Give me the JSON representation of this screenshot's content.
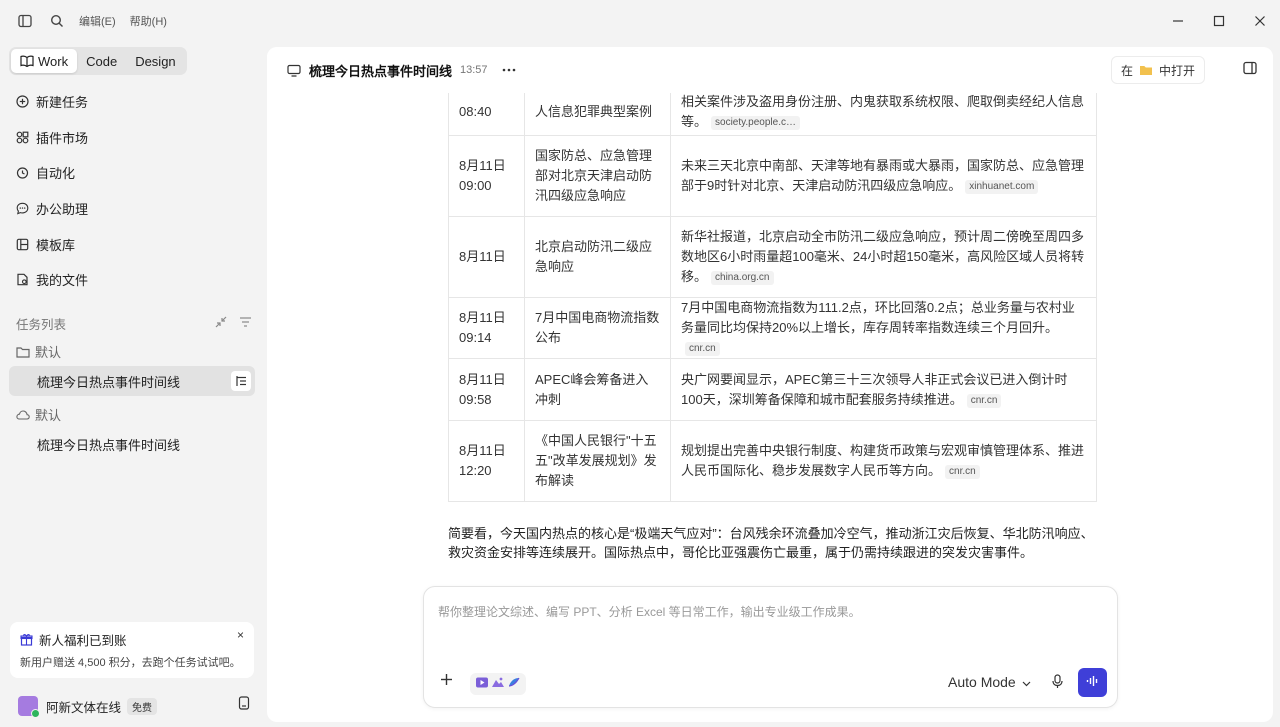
{
  "menu": {
    "edit": "编辑(E)",
    "help": "帮助(H)"
  },
  "mode_tabs": [
    {
      "label": "Work"
    },
    {
      "label": "Code"
    },
    {
      "label": "Design"
    }
  ],
  "nav": [
    {
      "label": "新建任务"
    },
    {
      "label": "插件市场"
    },
    {
      "label": "自动化"
    },
    {
      "label": "办公助理"
    },
    {
      "label": "模板库"
    },
    {
      "label": "我的文件"
    }
  ],
  "task_list": {
    "heading": "任务列表",
    "groups": [
      {
        "name": "默认",
        "task": "梳理今日热点事件时间线"
      },
      {
        "name": "默认",
        "task": "梳理今日热点事件时间线"
      }
    ]
  },
  "promo": {
    "title": "新人福利已到账",
    "desc": "新用户赠送 4,500 积分，去跑个任务试试吧。",
    "close": "×"
  },
  "user": {
    "name": "阿新文体在线",
    "plan": "免费"
  },
  "header": {
    "title": "梳理今日热点事件时间线",
    "time": "13:57",
    "open_prefix": "在",
    "open_label": "中打开"
  },
  "table": {
    "rows": [
      {
        "time": "08:40",
        "event": "人信息犯罪典型案例",
        "detail": "相关案件涉及盗用身份注册、内鬼获取系统权限、爬取倒卖经纪人信息等。",
        "source": "society.people.c…"
      },
      {
        "time": "8月11日 09:00",
        "event": "国家防总、应急管理部对北京天津启动防汛四级应急响应",
        "detail": "未来三天北京中南部、天津等地有暴雨或大暴雨，国家防总、应急管理部于9时针对北京、天津启动防汛四级应急响应。",
        "source": "xinhuanet.com"
      },
      {
        "time": "8月11日",
        "event": "北京启动防汛二级应急响应",
        "detail": "新华社报道，北京启动全市防汛二级应急响应，预计周二傍晚至周四多数地区6小时雨量超100毫米、24小时超150毫米，高风险区域人员将转移。",
        "source": "china.org.cn"
      },
      {
        "time": "8月11日 09:14",
        "event": "7月中国电商物流指数公布",
        "detail": "7月中国电商物流指数为111.2点，环比回落0.2点；总业务量与农村业务量同比均保持20%以上增长，库存周转率指数连续三个月回升。",
        "source": "cnr.cn"
      },
      {
        "time": "8月11日 09:58",
        "event": "APEC峰会筹备进入冲刺",
        "detail": "央广网要闻显示，APEC第三十三次领导人非正式会议已进入倒计时100天，深圳筹备保障和城市配套服务持续推进。",
        "source": "cnr.cn"
      },
      {
        "time": "8月11日 12:20",
        "event": "《中国人民银行\"十五五\"改革发展规划》发布解读",
        "detail": "规划提出完善中央银行制度、构建货币政策与宏观审慎管理体系、推进人民币国际化、稳步发展数字人民币等方向。",
        "source": "cnr.cn"
      }
    ]
  },
  "summary": "简要看，今天国内热点的核心是“极端天气应对”：台风残余环流叠加冷空气，推动浙江灾后恢复、华北防汛响应、救灾资金安排等连续展开。国际热点中，哥伦比亚强震伤亡最重，属于仍需持续跟进的突发灾害事件。",
  "composer": {
    "placeholder": "帮你整理论文综述、编写 PPT、分析 Excel 等日常工作，输出专业级工作成果。",
    "mode": "Auto Mode"
  },
  "colors": {
    "accent": "#3f3fd8",
    "sidebar_bg": "#f3f3f3",
    "panel_bg": "#ffffff"
  }
}
